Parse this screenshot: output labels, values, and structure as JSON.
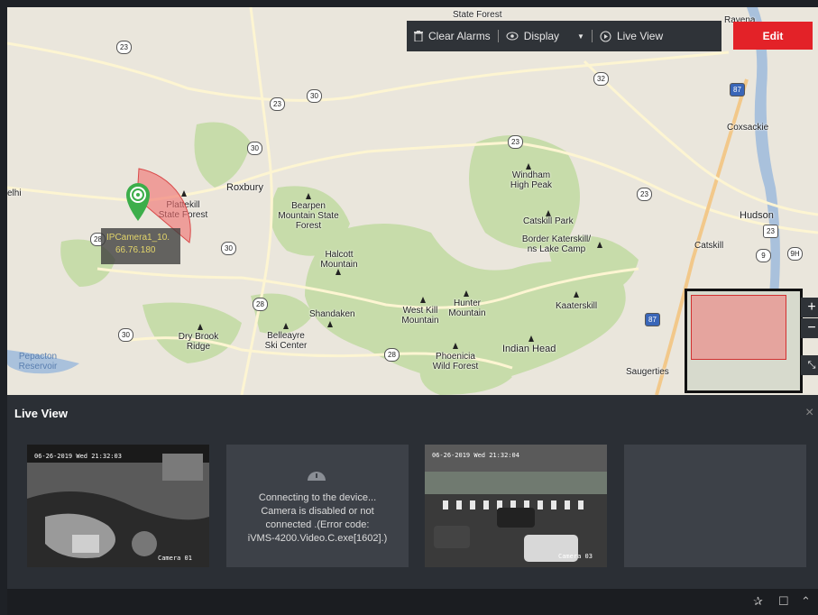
{
  "toolbar": {
    "clear_alarms_label": "Clear Alarms",
    "display_label": "Display",
    "live_view_label": "Live View",
    "edit_label": "Edit",
    "icons": [
      "trash-icon",
      "eye-icon",
      "caret-down-icon",
      "play-circle-icon"
    ]
  },
  "map": {
    "places": [
      {
        "name": "State Forest"
      },
      {
        "name": "Ravena"
      },
      {
        "name": "Coxsackie"
      },
      {
        "name": "Hudson"
      },
      {
        "name": "Catskill"
      },
      {
        "name": "Saugerties"
      },
      {
        "name": "Roxbury"
      },
      {
        "name": "Plattekill State Forest"
      },
      {
        "name": "Bearpen Mountain State Forest"
      },
      {
        "name": "Windham High Peak"
      },
      {
        "name": "Catskill Park"
      },
      {
        "name": "Border Katerskill/ ns Lake Camp"
      },
      {
        "name": "Halcott Mountain"
      },
      {
        "name": "Shandaken"
      },
      {
        "name": "West Kill Mountain"
      },
      {
        "name": "Hunter Mountain"
      },
      {
        "name": "Kaaterskill"
      },
      {
        "name": "Indian Head"
      },
      {
        "name": "Phoenicia Wild Forest"
      },
      {
        "name": "Dry Brook Ridge"
      },
      {
        "name": "Belleayre Ski Center"
      },
      {
        "name": "Pepacton Reservoir"
      },
      {
        "name": "elhi"
      }
    ],
    "route_shields": [
      "23",
      "23",
      "30",
      "30",
      "30",
      "32",
      "23",
      "23",
      "28",
      "30",
      "28",
      "28",
      "9",
      "9H",
      "87",
      "87",
      "23"
    ],
    "camera_label_line1": "IPCamera1_10.",
    "camera_label_line2": "66.76.180",
    "zoom_in_label": "+",
    "zoom_out_label": "−",
    "collapse_icon": "collapse-arrows-icon",
    "colors": {
      "forest": "#c7dcaa",
      "water": "#a9c1dc",
      "highway": "#f2c88a",
      "road": "#fdf5d2"
    }
  },
  "live_view": {
    "title": "Live View",
    "close_label": "×",
    "tiles": [
      {
        "osd_time": "06-26-2019 Wed 21:32:03",
        "osd_name": "Camera 01",
        "status": "live"
      },
      {
        "status": "error",
        "message_line1": "Connecting to the device...",
        "message_line2": "Camera is disabled or not",
        "message_line3": "connected .(Error code:",
        "message_line4": "iVMS-4200.Video.C.exe[1602].)"
      },
      {
        "osd_time": "06-26-2019 Wed 21:32:04",
        "osd_name": "Camera 03",
        "status": "live"
      },
      {
        "status": "empty"
      }
    ]
  },
  "bottom_bar": {
    "icons": [
      "pin-icon",
      "window-icon",
      "collapse-up-icon"
    ]
  }
}
